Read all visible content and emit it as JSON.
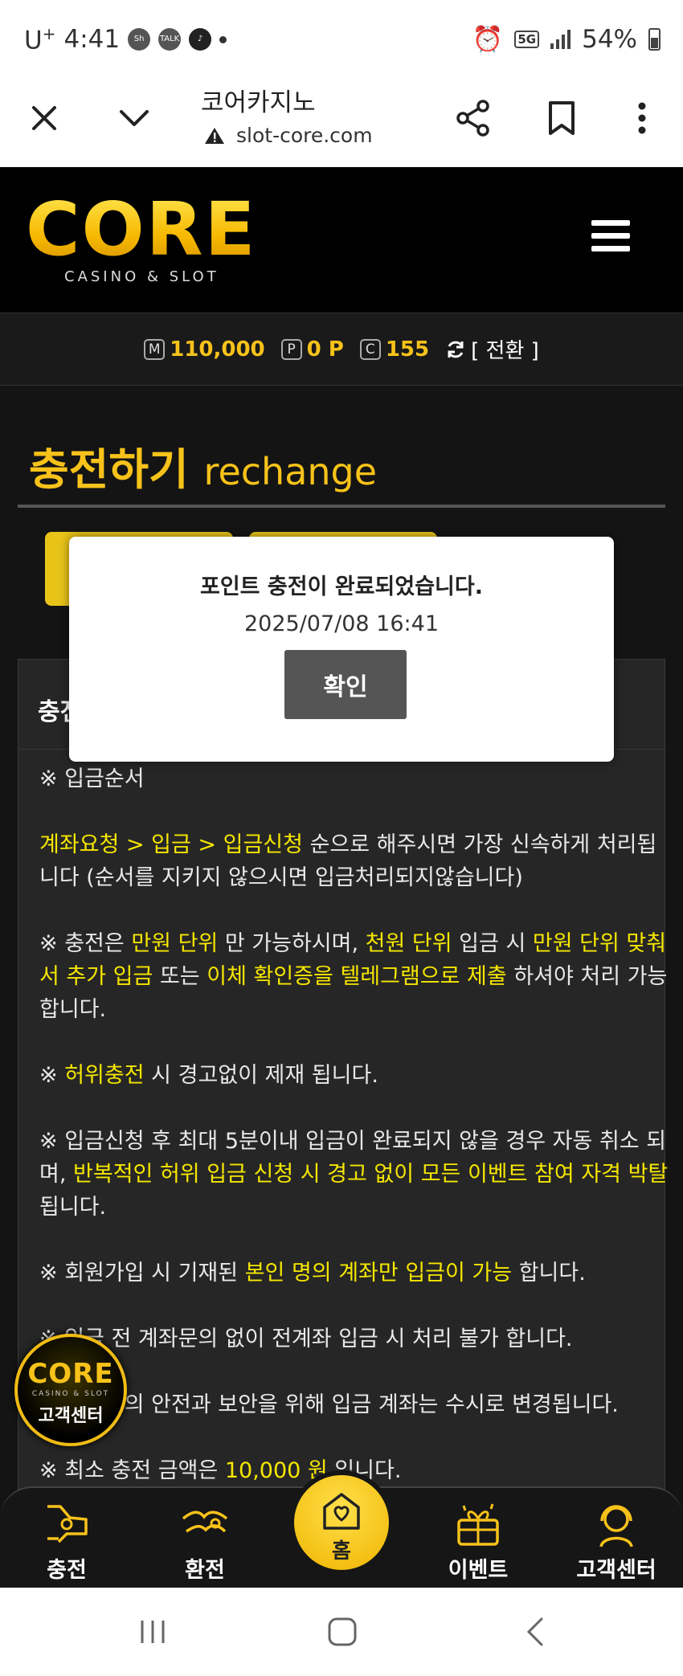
{
  "status_bar": {
    "carrier": "U",
    "carrier_sup": "+",
    "time": "4:41",
    "app_badges": [
      "Sh",
      "TALK"
    ],
    "battery": "54%",
    "network": "5G"
  },
  "browser": {
    "title": "코어카지노",
    "url": "slot-core.com",
    "icons": [
      "close-icon",
      "chevron-down-icon",
      "share-icon",
      "bookmark-icon",
      "more-vert-icon",
      "warning-icon"
    ]
  },
  "site": {
    "logo_word": "CORE",
    "logo_sub": "CASINO & SLOT"
  },
  "balance": {
    "money_tag": "M",
    "money": "110,000",
    "point_tag": "P",
    "point": "0 P",
    "coin_tag": "C",
    "coin": "155",
    "swap_label": "[ 전환 ]"
  },
  "page": {
    "title_ko": "충전하기",
    "title_en": "rechange",
    "box_header": "충전"
  },
  "rules": {
    "r1": "※ 입금순서",
    "r2a": "계좌요청 > 입금 > 입금신청",
    "r2b": " 순으로 해주시면 가장 신속하게 처리됩니다 (순서를 지키지 않으시면 입금처리되지않습니다)",
    "r3a": "※ 충전은 ",
    "r3b": "만원 단위",
    "r3c": " 만 가능하시며, ",
    "r3d": "천원 단위",
    "r3e": " 입금 시 ",
    "r3f": "만원 단위 맞춰서 추가 입금",
    "r3g": " 또는 ",
    "r3h": "이체 확인증을 텔레그램으로 제출",
    "r3i": " 하셔야 처리 가능합니다.",
    "r4a": "※ ",
    "r4b": "허위충전",
    "r4c": " 시 경고없이 제재 됩니다.",
    "r5a": "※ 입금신청 후 최대 5분이내 입금이 완료되지 않을 경우 자동 취소 되며, ",
    "r5b": "반복적인 허위 입금 신청 시 경고 없이 모든 이벤트 참여 자격 박탈",
    "r5c": "됩니다.",
    "r6a": "※ 회원가입 시 기재된 ",
    "r6b": "본인 명의 계좌만 입금이 가능",
    "r6c": " 합니다.",
    "r7": "※ 입금 전 계좌문의 없이 전계좌 입금 시 처리 불가 합니다.",
    "r8": "※ 회원님의 안전과 보안을 위해 입금 계좌는 수시로 변경됩니다.",
    "r9a": "※ 최소 충전 금액은 ",
    "r9b": "10,000 원",
    "r9c": " 입니다."
  },
  "modal": {
    "message": "포인트 충전이 완료되었습니다.",
    "datetime": "2025/07/08 16:41",
    "confirm": "확인"
  },
  "cs_badge": {
    "word": "CORE",
    "sub": "CASINO & SLOT",
    "label": "고객센터"
  },
  "bottom_nav": {
    "deposit": "충전",
    "withdraw": "환전",
    "home": "홈",
    "event": "이벤트",
    "support": "고객센터"
  },
  "colors": {
    "accent_gold": "#f7c21a",
    "highlight_yellow": "#f5e600",
    "background": "#141414"
  }
}
